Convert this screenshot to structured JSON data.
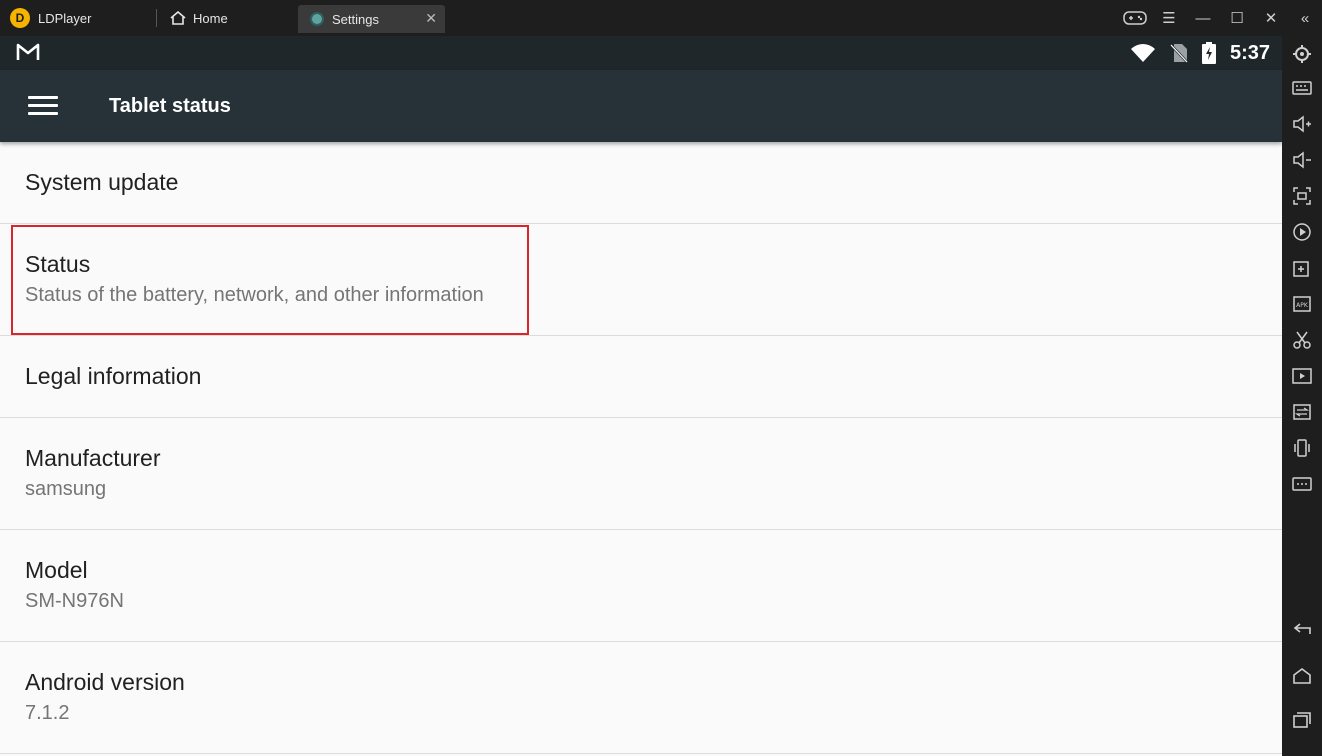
{
  "window": {
    "app_name": "LDPlayer",
    "tabs": [
      {
        "label": "Home"
      },
      {
        "label": "Settings"
      }
    ]
  },
  "android": {
    "clock": "5:37",
    "appbar_title": "Tablet status",
    "items": [
      {
        "title": "System update",
        "subtitle": ""
      },
      {
        "title": "Status",
        "subtitle": "Status of the battery, network, and other information"
      },
      {
        "title": "Legal information",
        "subtitle": ""
      },
      {
        "title": "Manufacturer",
        "subtitle": "samsung"
      },
      {
        "title": "Model",
        "subtitle": "SM-N976N"
      },
      {
        "title": "Android version",
        "subtitle": "7.1.2"
      }
    ]
  },
  "colors": {
    "statusbar": "#1f272b",
    "appbar": "#263238",
    "highlight": "#d9262a",
    "brand": "#f5b400"
  },
  "sidebar_icons": [
    "settings-icon",
    "keyboard-icon",
    "volume-up-icon",
    "volume-down-icon",
    "fullscreen-icon",
    "operation-record-icon",
    "add-app-icon",
    "apk-icon",
    "scissors-icon",
    "video-record-icon",
    "sync-icon",
    "shake-icon",
    "more-icon",
    "back-icon",
    "home-icon",
    "recents-icon"
  ]
}
